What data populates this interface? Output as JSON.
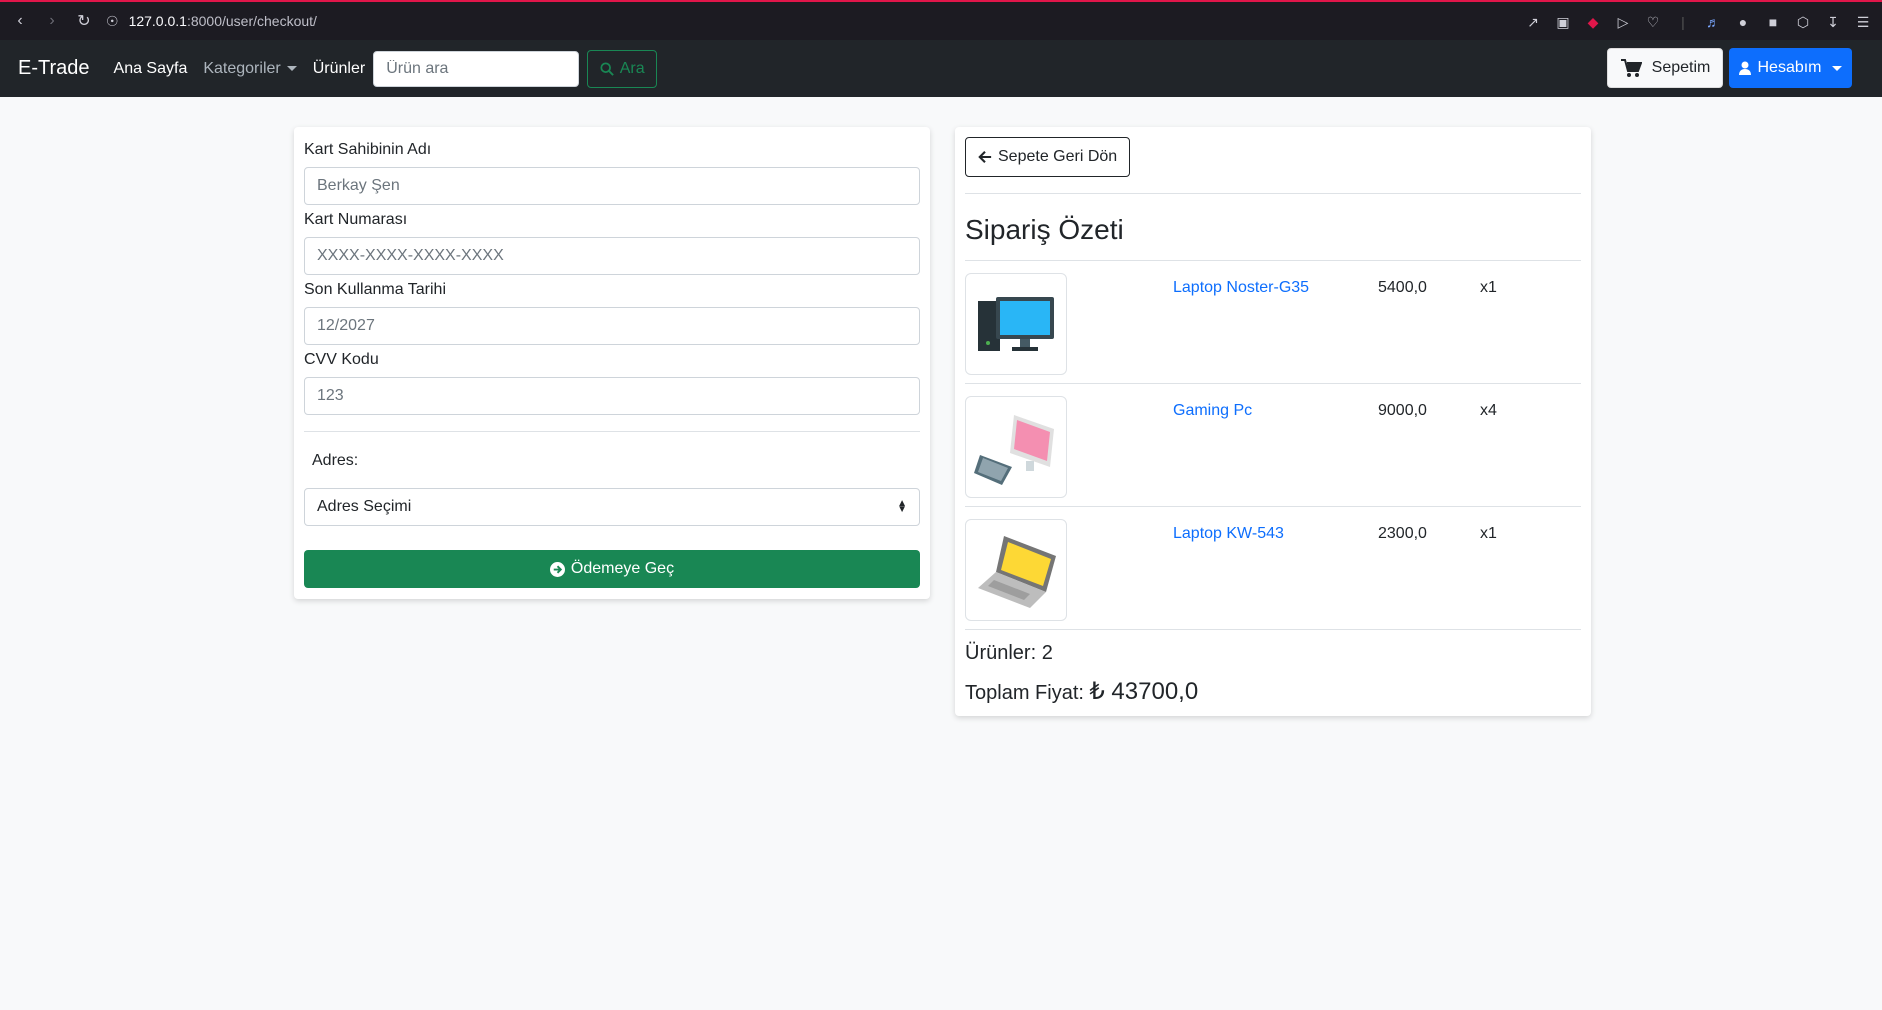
{
  "browser": {
    "url_host": "127.0.0.1",
    "url_rest": ":8000/user/checkout/"
  },
  "navbar": {
    "brand": "E-Trade",
    "home": "Ana Sayfa",
    "categories": "Kategoriler",
    "products": "Ürünler",
    "search_placeholder": "Ürün ara",
    "search_button": "Ara",
    "cart_button": "Sepetim",
    "account_button": "Hesabım"
  },
  "form": {
    "card_holder_label": "Kart Sahibinin Adı",
    "card_holder_placeholder": "Berkay Şen",
    "card_number_label": "Kart Numarası",
    "card_number_placeholder": "XXXX-XXXX-XXXX-XXXX",
    "expiry_label": "Son Kullanma Tarihi",
    "expiry_placeholder": "12/2027",
    "cvv_label": "CVV Kodu",
    "cvv_placeholder": "123",
    "address_label": "Adres:",
    "address_select": "Adres Seçimi",
    "pay_button": "Ödemeye Geç"
  },
  "summary": {
    "back_button": "Sepete Geri Dön",
    "title": "Sipariş Özeti",
    "items": [
      {
        "name": "Laptop Noster-G35",
        "price": "5400,0",
        "qty": "x1",
        "image_icon": "desktop-pc-icon"
      },
      {
        "name": "Gaming Pc",
        "price": "9000,0",
        "qty": "x4",
        "image_icon": "pink-monitor-keyboard-icon"
      },
      {
        "name": "Laptop KW-543",
        "price": "2300,0",
        "qty": "x1",
        "image_icon": "yellow-laptop-icon"
      }
    ],
    "count_text": "Ürünler: 2",
    "total_label": "Toplam Fiyat: ",
    "total_amount": "₺ 43700,0"
  },
  "colors": {
    "primary": "#0d6efd",
    "success": "#198754",
    "navbar": "#212529"
  }
}
